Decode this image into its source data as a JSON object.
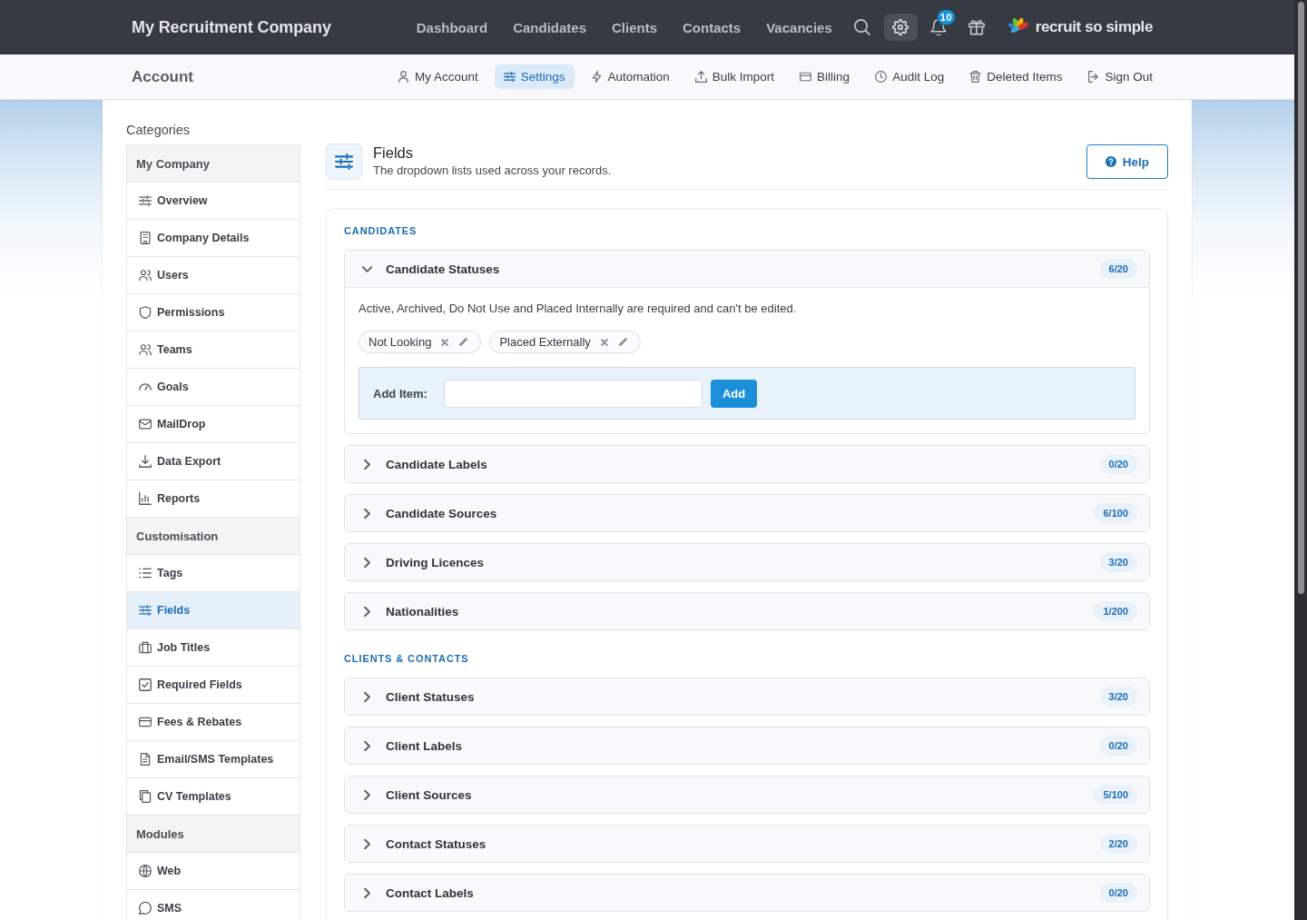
{
  "topbar": {
    "brand": "My Recruitment Company",
    "nav": [
      "Dashboard",
      "Candidates",
      "Clients",
      "Contacts",
      "Vacancies"
    ],
    "icon_buttons": [
      {
        "selected": false
      },
      {
        "selected": true
      },
      {
        "selected": false,
        "badge": "10"
      },
      {
        "selected": false
      }
    ],
    "logo_text": "recruit so simple"
  },
  "subbar": {
    "title": "Account",
    "tabs": [
      {
        "label": "My Account",
        "selected": false
      },
      {
        "label": "Settings",
        "selected": true
      },
      {
        "label": "Automation",
        "selected": false
      },
      {
        "label": "Bulk Import",
        "selected": false
      },
      {
        "label": "Billing",
        "selected": false
      },
      {
        "label": "Audit Log",
        "selected": false
      },
      {
        "label": "Deleted Items",
        "selected": false
      },
      {
        "label": "Sign Out",
        "selected": false
      }
    ]
  },
  "sidebar": {
    "title": "Categories",
    "groups": [
      {
        "label": "My Company",
        "items": [
          {
            "label": "Overview",
            "selected": false
          },
          {
            "label": "Company Details",
            "selected": false
          },
          {
            "label": "Users",
            "selected": false
          },
          {
            "label": "Permissions",
            "selected": false
          },
          {
            "label": "Teams",
            "selected": false
          },
          {
            "label": "Goals",
            "selected": false
          },
          {
            "label": "MailDrop",
            "selected": false
          },
          {
            "label": "Data Export",
            "selected": false
          },
          {
            "label": "Reports",
            "selected": false
          }
        ]
      },
      {
        "label": "Customisation",
        "items": [
          {
            "label": "Tags",
            "selected": false
          },
          {
            "label": "Fields",
            "selected": true
          },
          {
            "label": "Job Titles",
            "selected": false
          },
          {
            "label": "Required Fields",
            "selected": false
          },
          {
            "label": "Fees & Rebates",
            "selected": false
          },
          {
            "label": "Email/SMS Templates",
            "selected": false
          },
          {
            "label": "CV Templates",
            "selected": false
          }
        ]
      },
      {
        "label": "Modules",
        "items": [
          {
            "label": "Web",
            "selected": false
          },
          {
            "label": "SMS",
            "selected": false
          }
        ]
      }
    ]
  },
  "page_header": {
    "title": "Fields",
    "subtitle": "The dropdown lists used across your records.",
    "help_button": "Help"
  },
  "sections": [
    {
      "heading": "CANDIDATES",
      "lists": [
        {
          "title": "Candidate Statuses",
          "count": "6/20",
          "expanded": true,
          "note": "Active, Archived, Do Not Use and Placed Internally are required and can't be edited.",
          "items": [
            "Not Looking",
            "Placed Externally"
          ],
          "add_label": "Add Item:",
          "add_button": "Add"
        },
        {
          "title": "Candidate Labels",
          "count": "0/20",
          "expanded": false
        },
        {
          "title": "Candidate Sources",
          "count": "6/100",
          "expanded": false
        },
        {
          "title": "Driving Licences",
          "count": "3/20",
          "expanded": false
        },
        {
          "title": "Nationalities",
          "count": "1/200",
          "expanded": false
        }
      ]
    },
    {
      "heading": "CLIENTS & CONTACTS",
      "lists": [
        {
          "title": "Client Statuses",
          "count": "3/20",
          "expanded": false
        },
        {
          "title": "Client Labels",
          "count": "0/20",
          "expanded": false
        },
        {
          "title": "Client Sources",
          "count": "5/100",
          "expanded": false
        },
        {
          "title": "Contact Statuses",
          "count": "2/20",
          "expanded": false
        },
        {
          "title": "Contact Labels",
          "count": "0/20",
          "expanded": false
        }
      ]
    }
  ]
}
